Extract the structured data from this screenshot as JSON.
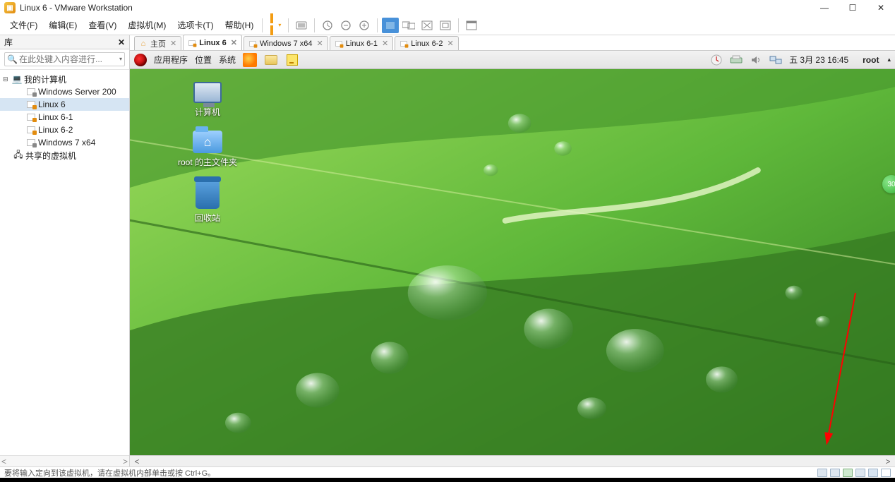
{
  "titlebar": {
    "title": "Linux 6 - VMware Workstation"
  },
  "menubar": {
    "items": [
      "文件(F)",
      "编辑(E)",
      "查看(V)",
      "虚拟机(M)",
      "选项卡(T)",
      "帮助(H)"
    ]
  },
  "library": {
    "header": "库",
    "search_placeholder": "在此处键入内容进行...",
    "root": "我的计算机",
    "vms": [
      {
        "name": "Windows Server 200",
        "state": "off"
      },
      {
        "name": "Linux 6",
        "state": "running",
        "selected": true
      },
      {
        "name": "Linux 6-1",
        "state": "running"
      },
      {
        "name": "Linux 6-2",
        "state": "running"
      },
      {
        "name": "Windows 7 x64",
        "state": "off"
      }
    ],
    "shared": "共享的虚拟机"
  },
  "tabs": [
    {
      "label": "主页",
      "kind": "home",
      "active": false
    },
    {
      "label": "Linux 6",
      "kind": "vm",
      "active": true
    },
    {
      "label": "Windows 7 x64",
      "kind": "vm",
      "active": false
    },
    {
      "label": "Linux 6-1",
      "kind": "vm",
      "active": false
    },
    {
      "label": "Linux 6-2",
      "kind": "vm",
      "active": false
    }
  ],
  "guest": {
    "menus": [
      "应用程序",
      "位置",
      "系统"
    ],
    "datetime": "五  3月  23 16:45",
    "user": "root",
    "desktop_icons": [
      {
        "id": "computer",
        "label": "计算机"
      },
      {
        "id": "home",
        "label": "root 的主文件夹"
      },
      {
        "id": "trash",
        "label": "回收站"
      }
    ],
    "bubble": "30"
  },
  "statusbar": {
    "hint": "要将输入定向到该虚拟机，请在虚拟机内部单击或按 Ctrl+G。"
  }
}
